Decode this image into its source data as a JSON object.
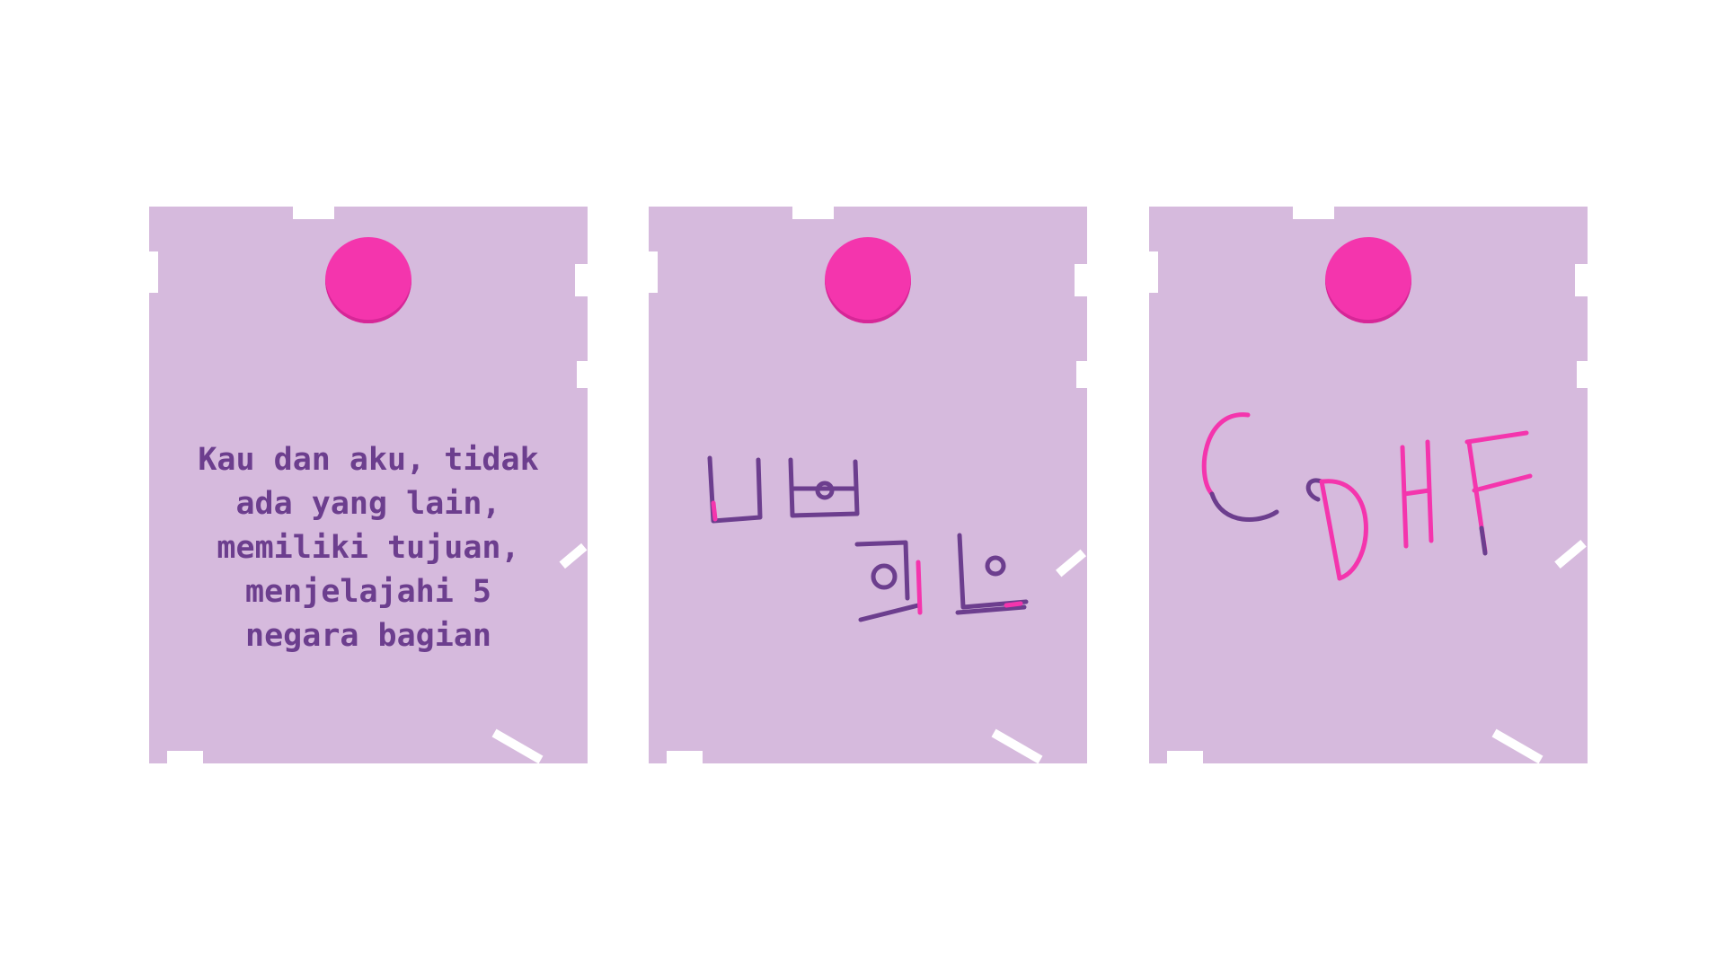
{
  "notes": [
    {
      "id": "note-1",
      "pin_color": "#f435ad",
      "text": "Kau dan aku, tidak\nada yang lain,\nmemiliki tujuan,\nmenjelajahi 5\nnegara bagian"
    },
    {
      "id": "note-2",
      "pin_color": "#f435ad",
      "drawing": "hangul-crayon-sketch"
    },
    {
      "id": "note-3",
      "pin_color": "#f435ad",
      "drawing": "letters-CDHF-crayon",
      "letters": "CDHF"
    }
  ],
  "colors": {
    "background": "#ffffff",
    "paper": "#d6badd",
    "pin": "#f435ad",
    "ink_purple": "#6c3e8e",
    "ink_pink": "#f435ad"
  }
}
